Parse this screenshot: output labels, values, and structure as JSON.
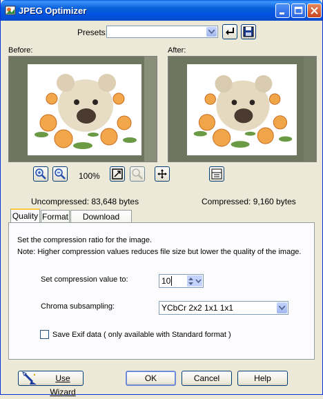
{
  "window": {
    "title": "JPEG Optimizer"
  },
  "presets": {
    "label": "Presets:",
    "value": ""
  },
  "preview": {
    "before_label": "Before:",
    "after_label": "After:",
    "zoom": "100%",
    "uncompressed": "Uncompressed:  83,648 bytes",
    "compressed": "Compressed: 9,160 bytes"
  },
  "tabs": [
    {
      "label": "Quality"
    },
    {
      "label": "Format"
    },
    {
      "label": "Download Times"
    }
  ],
  "quality": {
    "intro": "Set the compression ratio for the image.",
    "note": "Note:  Higher compression values reduces file size but lower the quality of the image.",
    "compression_label": "Set compression value to:",
    "compression_value": "10",
    "chroma_label": "Chroma subsampling:",
    "chroma_value": "YCbCr  2x2  1x1  1x1",
    "exif_label": "Save Exif data ( only available with Standard format )",
    "exif_checked": false
  },
  "buttons": {
    "wizard": "Use Wizard",
    "ok": "OK",
    "cancel": "Cancel",
    "help": "Help"
  }
}
